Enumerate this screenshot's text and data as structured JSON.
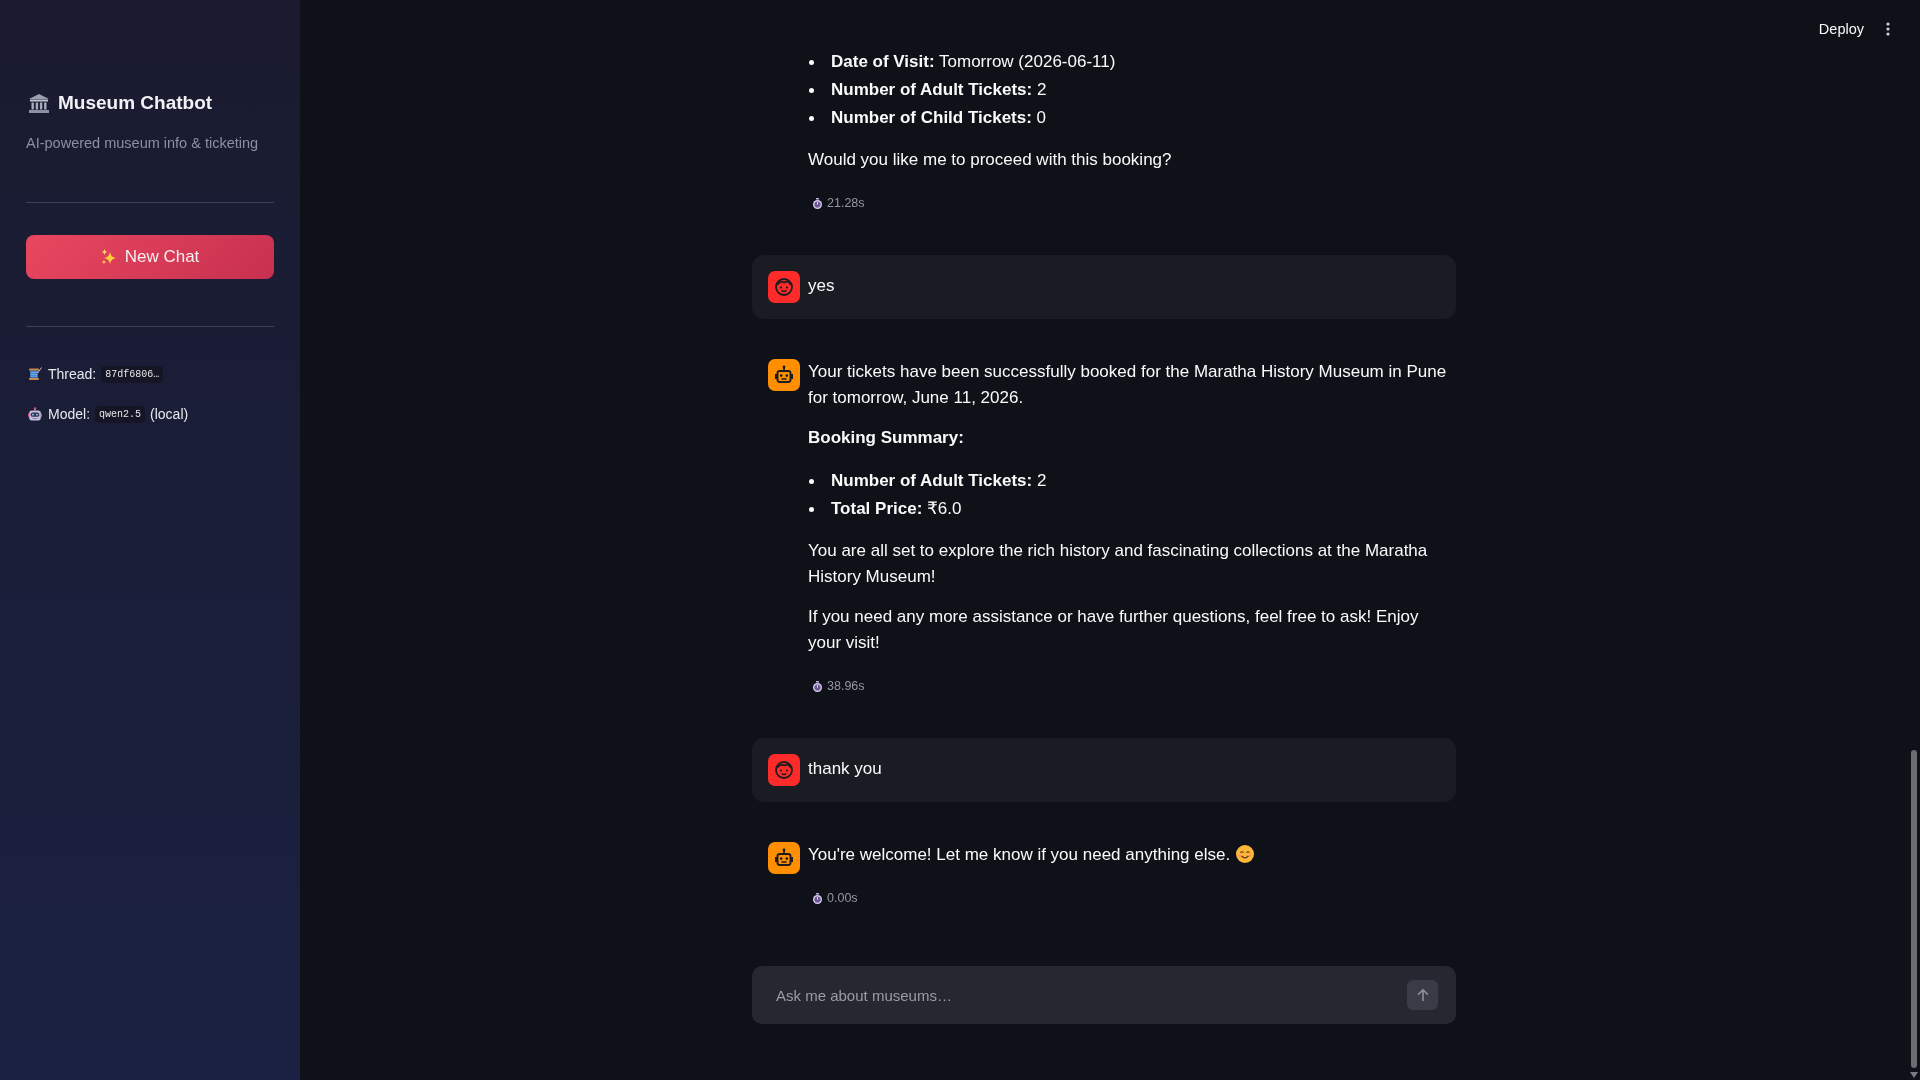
{
  "sidebar": {
    "title": "Museum Chatbot",
    "subtitle": "AI-powered museum info & ticketing",
    "new_chat_button": "New Chat",
    "info": [
      {
        "kind": "thread",
        "label": "Thread:",
        "code": "87df6806…"
      },
      {
        "kind": "model",
        "label": "Model:",
        "code": "qwen2.5",
        "suffix": "(local)"
      }
    ]
  },
  "toolbar": {
    "deploy": "Deploy"
  },
  "messages": [
    {
      "kind": "assistant",
      "avatar": false,
      "blocks": [
        {
          "kind": "list",
          "items": [
            "**Date of Visit:** Tomorrow (2026-06-11)",
            "**Number of Adult Tickets:** 2",
            "**Number of Child Tickets:** 0"
          ]
        },
        {
          "kind": "paragraph",
          "text": "Would you like me to proceed with this booking?"
        }
      ],
      "time": "21.28s"
    },
    {
      "kind": "user",
      "avatar": true,
      "blocks": [
        {
          "kind": "paragraph",
          "text": "yes"
        }
      ]
    },
    {
      "kind": "assistant",
      "avatar": true,
      "blocks": [
        {
          "kind": "paragraph",
          "text": "Your tickets have been successfully booked for the Maratha History Museum in Pune for tomorrow, June 11, 2026."
        },
        {
          "kind": "heading",
          "text": "Booking Summary:"
        },
        {
          "kind": "list",
          "items": [
            "**Number of Adult Tickets:** 2",
            "**Total Price:** ₹6.0"
          ]
        },
        {
          "kind": "paragraph",
          "text": "You are all set to explore the rich history and fascinating collections at the Maratha History Museum!"
        },
        {
          "kind": "paragraph",
          "text": "If you need any more assistance or have further questions, feel free to ask! Enjoy your visit!"
        }
      ],
      "time": "38.96s"
    },
    {
      "kind": "user",
      "avatar": true,
      "blocks": [
        {
          "kind": "paragraph",
          "text": "thank you"
        }
      ]
    },
    {
      "kind": "assistant",
      "avatar": true,
      "blocks": [
        {
          "kind": "paragraph",
          "text": "You're welcome! Let me know if you need anything else.",
          "emoji": true
        }
      ],
      "time": "0.00s"
    }
  ],
  "chat_input": {
    "placeholder": "Ask me about museums…"
  }
}
